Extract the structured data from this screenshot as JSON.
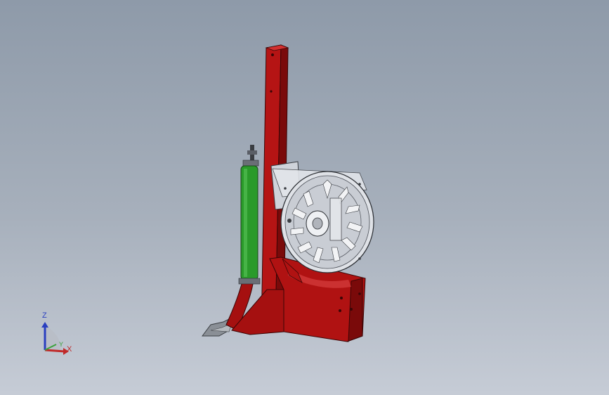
{
  "viewport": {
    "background_top": "#8e9aa9",
    "background_bottom": "#c6ccd6"
  },
  "model": {
    "frame_color": "#b01212",
    "frame_shadow": "#7a0a0a",
    "spring_color": "#2a9a2a",
    "housing_color": "#d9dde3",
    "shoe_color": "#8a8f96"
  },
  "triad": {
    "z_label": "Z",
    "y_label": "Y",
    "x_label": "X",
    "z_color": "#2a3fc0",
    "y_color": "#3aa13a",
    "x_color": "#c02a2a"
  }
}
